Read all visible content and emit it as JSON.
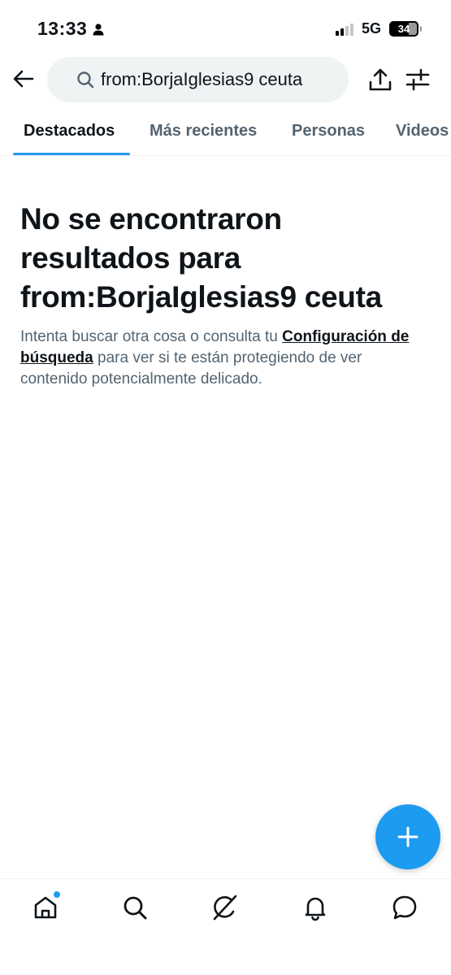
{
  "status_bar": {
    "time": "13:33",
    "network": "5G",
    "battery": "34"
  },
  "header": {
    "search_query": "from:BorjaIglesias9 ceuta"
  },
  "tabs": [
    {
      "label": "Destacados",
      "active": true
    },
    {
      "label": "Más recientes",
      "active": false
    },
    {
      "label": "Personas",
      "active": false
    },
    {
      "label": "Videos",
      "active": false
    }
  ],
  "empty_state": {
    "title_line1": "No se encontraron",
    "title_line2": "resultados para",
    "title_line3": "from:BorjaIglesias9 ceuta",
    "desc_before": "Intenta buscar otra cosa o consulta tu ",
    "desc_link": "Configuración de búsqueda",
    "desc_after": " para ver si te están protegiendo de ver contenido potencialmente delicado."
  },
  "fab": {
    "icon": "plus-icon"
  },
  "bottom_nav": [
    {
      "icon": "home-icon",
      "has_dot": true
    },
    {
      "icon": "search-icon"
    },
    {
      "icon": "grok-icon"
    },
    {
      "icon": "bell-icon"
    },
    {
      "icon": "message-icon"
    }
  ],
  "colors": {
    "accent": "#1d9bf0",
    "text_primary": "#0f1419",
    "text_secondary": "#536471",
    "search_bg": "#eff3f4"
  }
}
